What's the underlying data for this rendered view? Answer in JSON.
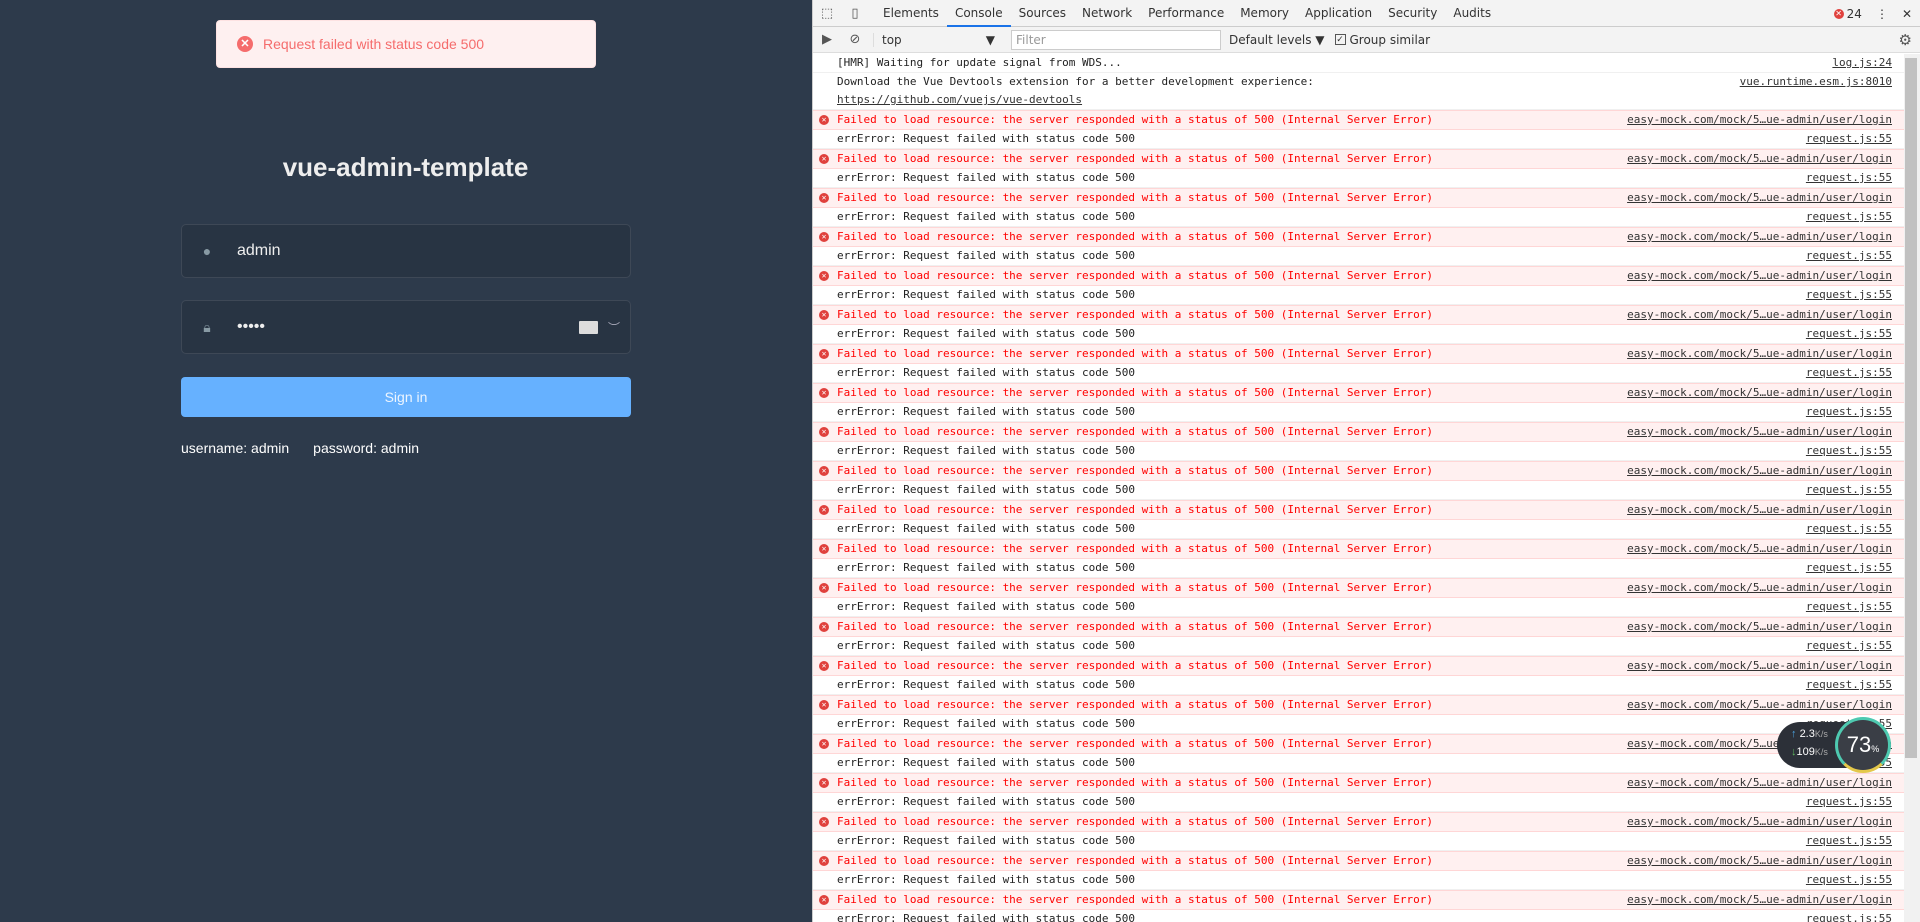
{
  "login": {
    "toast": "Request failed with status code 500",
    "title": "vue-admin-template",
    "username": "admin",
    "password_mask": "•••••",
    "sign_in": "Sign in",
    "hint_user": "username: admin",
    "hint_pass": "password: admin"
  },
  "devtools": {
    "tabs": [
      "Elements",
      "Console",
      "Sources",
      "Network",
      "Performance",
      "Memory",
      "Application",
      "Security",
      "Audits"
    ],
    "active_tab": "Console",
    "error_count": "24",
    "context": "top",
    "filter_placeholder": "Filter",
    "levels": "Default levels",
    "group_similar": "Group similar",
    "messages": [
      {
        "text": "[HMR] Waiting for update signal from WDS...",
        "source": "log.js:24"
      },
      {
        "text": "Download the Vue Devtools extension for a better development experience:",
        "link": "https://github.com/vuejs/vue-devtools",
        "source": "vue.runtime.esm.js:8010"
      }
    ],
    "repeated": {
      "error": {
        "text": "Failed to load resource: the server responded with a status of 500 (Internal Server Error)",
        "source": "easy-mock.com/mock/5…ue-admin/user/login"
      },
      "log": {
        "text": "errError: Request failed with status code 500",
        "source": "request.js:55"
      },
      "repeat": 22
    }
  },
  "net_widget": {
    "up": "2.3",
    "down": "109",
    "unit": "K/s",
    "percent": "73",
    "percent_sign": "%"
  }
}
